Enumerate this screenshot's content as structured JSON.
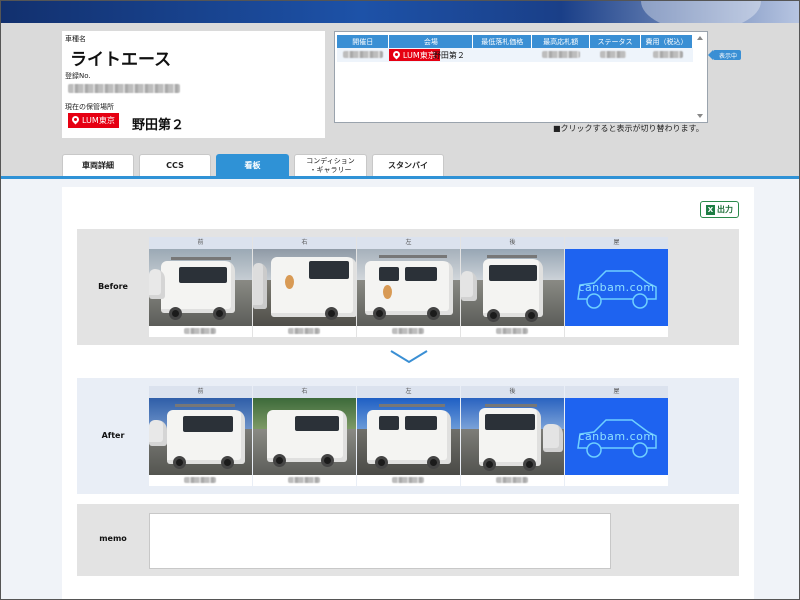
{
  "vehicle": {
    "name_label": "車種名",
    "name": "ライトエース",
    "reg_label": "登録No.",
    "location_label": "現在の保管場所",
    "location_tag": "LUM東京",
    "location_name": "野田第２"
  },
  "history_table": {
    "headers": [
      "開催日",
      "会場",
      "最低落札価格",
      "最高応札額",
      "ステータス",
      "費用（税込）"
    ],
    "row": {
      "venue_tag": "LUM東京",
      "venue_name": "野田第２"
    }
  },
  "display_badge": "表示中",
  "click_note": "■クリックすると表示が切り替わります。",
  "tabs": [
    {
      "label": "車両詳細",
      "active": false
    },
    {
      "label": "CCS",
      "active": false
    },
    {
      "label": "看板",
      "active": true
    },
    {
      "label_line1": "コンディション",
      "label_line2": "・ギャラリー",
      "active": false
    },
    {
      "label": "スタンバイ",
      "active": false
    }
  ],
  "export_button": "出力",
  "photo_columns": [
    "前",
    "右",
    "左",
    "後",
    "屋"
  ],
  "rows": {
    "before_label": "Before",
    "after_label": "After"
  },
  "placeholder_brand": "canbam.com",
  "memo_label": "memo",
  "memo_value": "",
  "colors": {
    "accent_blue": "#2f92d6",
    "tag_red": "#e60012",
    "placeholder_blue": "#1e63f0",
    "excel_green": "#1e7e44"
  },
  "icons": {
    "pin": "map-pin-icon",
    "excel": "excel-icon",
    "chevron": "chevron-down-icon"
  }
}
